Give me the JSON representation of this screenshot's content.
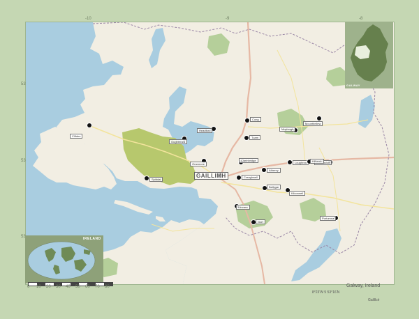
{
  "map": {
    "title": "Galway, Ireland",
    "coords": "8°23'W 5 53°16'N",
    "attribution": "Galillcé",
    "capital": "GAILLIMH",
    "inset_region": "GALWAY",
    "world_region": "IRELAND",
    "top_ticks": [
      "-10",
      "-9",
      "-8"
    ],
    "left_ticks": [
      "53",
      "53",
      "53"
    ],
    "scale_bar": [
      "0",
      "10",
      "20",
      "30",
      "40",
      "50",
      "60",
      "70",
      "80"
    ],
    "places": [
      "Cong",
      "Headford",
      "Tuam",
      "Moylough",
      "Mountbellew",
      "Oughterard",
      "Clifden",
      "Spiddal",
      "Athenry",
      "Loughrea",
      "Ballinasloe",
      "Kilconnell",
      "Gort",
      "Portumna",
      "Craughwell",
      "Clarinbridge",
      "Kinvara",
      "Oranmore",
      "Ballygar",
      "Kilkerrin"
    ],
    "colors": {
      "water": "#a9cde0",
      "land": "#f2eee3",
      "forest": "#b5cf9a",
      "park": "#b7c86d",
      "road": "#f3e49c",
      "primary": "#e6b8a4",
      "frame": "#c5d7b3"
    }
  }
}
